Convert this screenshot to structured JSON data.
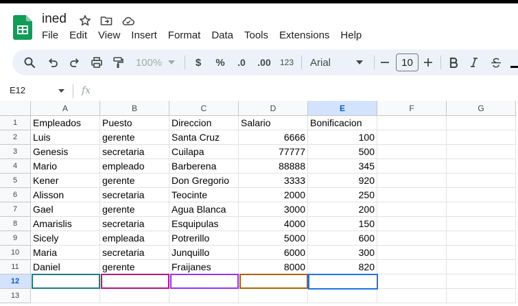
{
  "doc": {
    "title": "ined"
  },
  "menu": [
    "File",
    "Edit",
    "View",
    "Insert",
    "Format",
    "Data",
    "Tools",
    "Extensions",
    "Help"
  ],
  "toolbar": {
    "zoom": "100%",
    "currency": "$",
    "percent": "%",
    "dec_decrease": ".0",
    "dec_increase": ".00",
    "number_format": "123",
    "font": "Arial",
    "font_size": "10"
  },
  "formula_bar": {
    "name_box": "E12",
    "fx": "fx"
  },
  "columns": [
    "A",
    "B",
    "C",
    "D",
    "E",
    "F",
    "G"
  ],
  "rows": [
    "1",
    "2",
    "3",
    "4",
    "5",
    "6",
    "7",
    "8",
    "9",
    "10",
    "11",
    "12",
    "13"
  ],
  "selected": {
    "cell": "E12",
    "column": "E",
    "row": "12"
  },
  "sheet": {
    "header": [
      "Empleados",
      "Puesto",
      "Direccion",
      "Salario",
      "Bonificacion"
    ],
    "data": [
      [
        "Luis",
        "gerente",
        "Santa Cruz",
        "6666",
        "100"
      ],
      [
        "Genesis",
        "secretaria",
        "Cuilapa",
        "77777",
        "500"
      ],
      [
        "Mario",
        "empleado",
        "Barberena",
        "88888",
        "345"
      ],
      [
        "Kener",
        "gerente",
        "Don Gregorio",
        "3333",
        "920"
      ],
      [
        "Alisson",
        "secretaria",
        "Teocinte",
        "2000",
        "250"
      ],
      [
        "Gael",
        "gerente",
        "Agua Blanca",
        "3000",
        "200"
      ],
      [
        "Amarislis",
        "secretaria",
        "Esquipulas",
        "4000",
        "150"
      ],
      [
        "Sicely",
        "empleada",
        "Potrerillo",
        "5000",
        "600"
      ],
      [
        "Maria",
        "secretaria",
        "Junquillo",
        "6000",
        "300"
      ],
      [
        "Daniel",
        "gerente",
        "Fraijanes",
        "8000",
        "820"
      ]
    ]
  },
  "colors": {
    "collab_a": "#1b7a83",
    "collab_b": "#b3137c",
    "collab_c": "#9334e6",
    "collab_d": "#b06000",
    "selection": "#1a73e8"
  }
}
